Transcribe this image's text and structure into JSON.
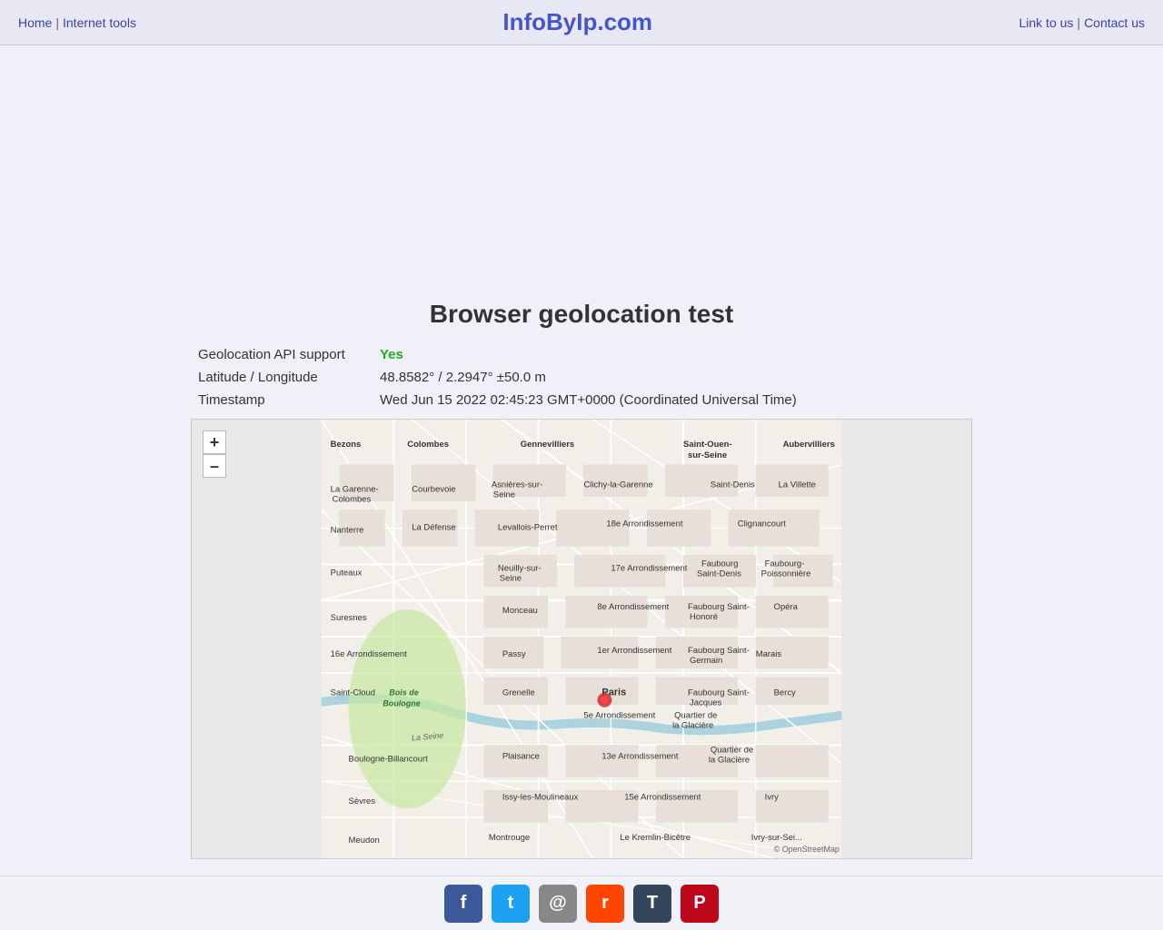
{
  "header": {
    "site_title": "InfoByIp.com",
    "nav_home": "Home",
    "nav_separator1": "|",
    "nav_internet_tools": "Internet tools",
    "nav_link_to_us": "Link to us",
    "nav_separator2": "|",
    "nav_contact_us": "Contact us"
  },
  "page": {
    "heading": "Browser geolocation test",
    "geo_api_label": "Geolocation API support",
    "geo_api_value": "Yes",
    "lat_lng_label": "Latitude / Longitude",
    "lat_lng_value": "48.8582° / 2.2947° ±50.0 m",
    "timestamp_label": "Timestamp",
    "timestamp_value": "Wed Jun 15 2022 02:45:23 GMT+0000 (Coordinated Universal Time)"
  },
  "map": {
    "zoom_in_label": "+",
    "zoom_out_label": "–",
    "attribution": "© OpenStreetMap contributors"
  },
  "social": {
    "facebook_label": "f",
    "twitter_label": "t",
    "email_label": "@",
    "reddit_label": "r",
    "tumblr_label": "T",
    "pinterest_label": "P"
  }
}
